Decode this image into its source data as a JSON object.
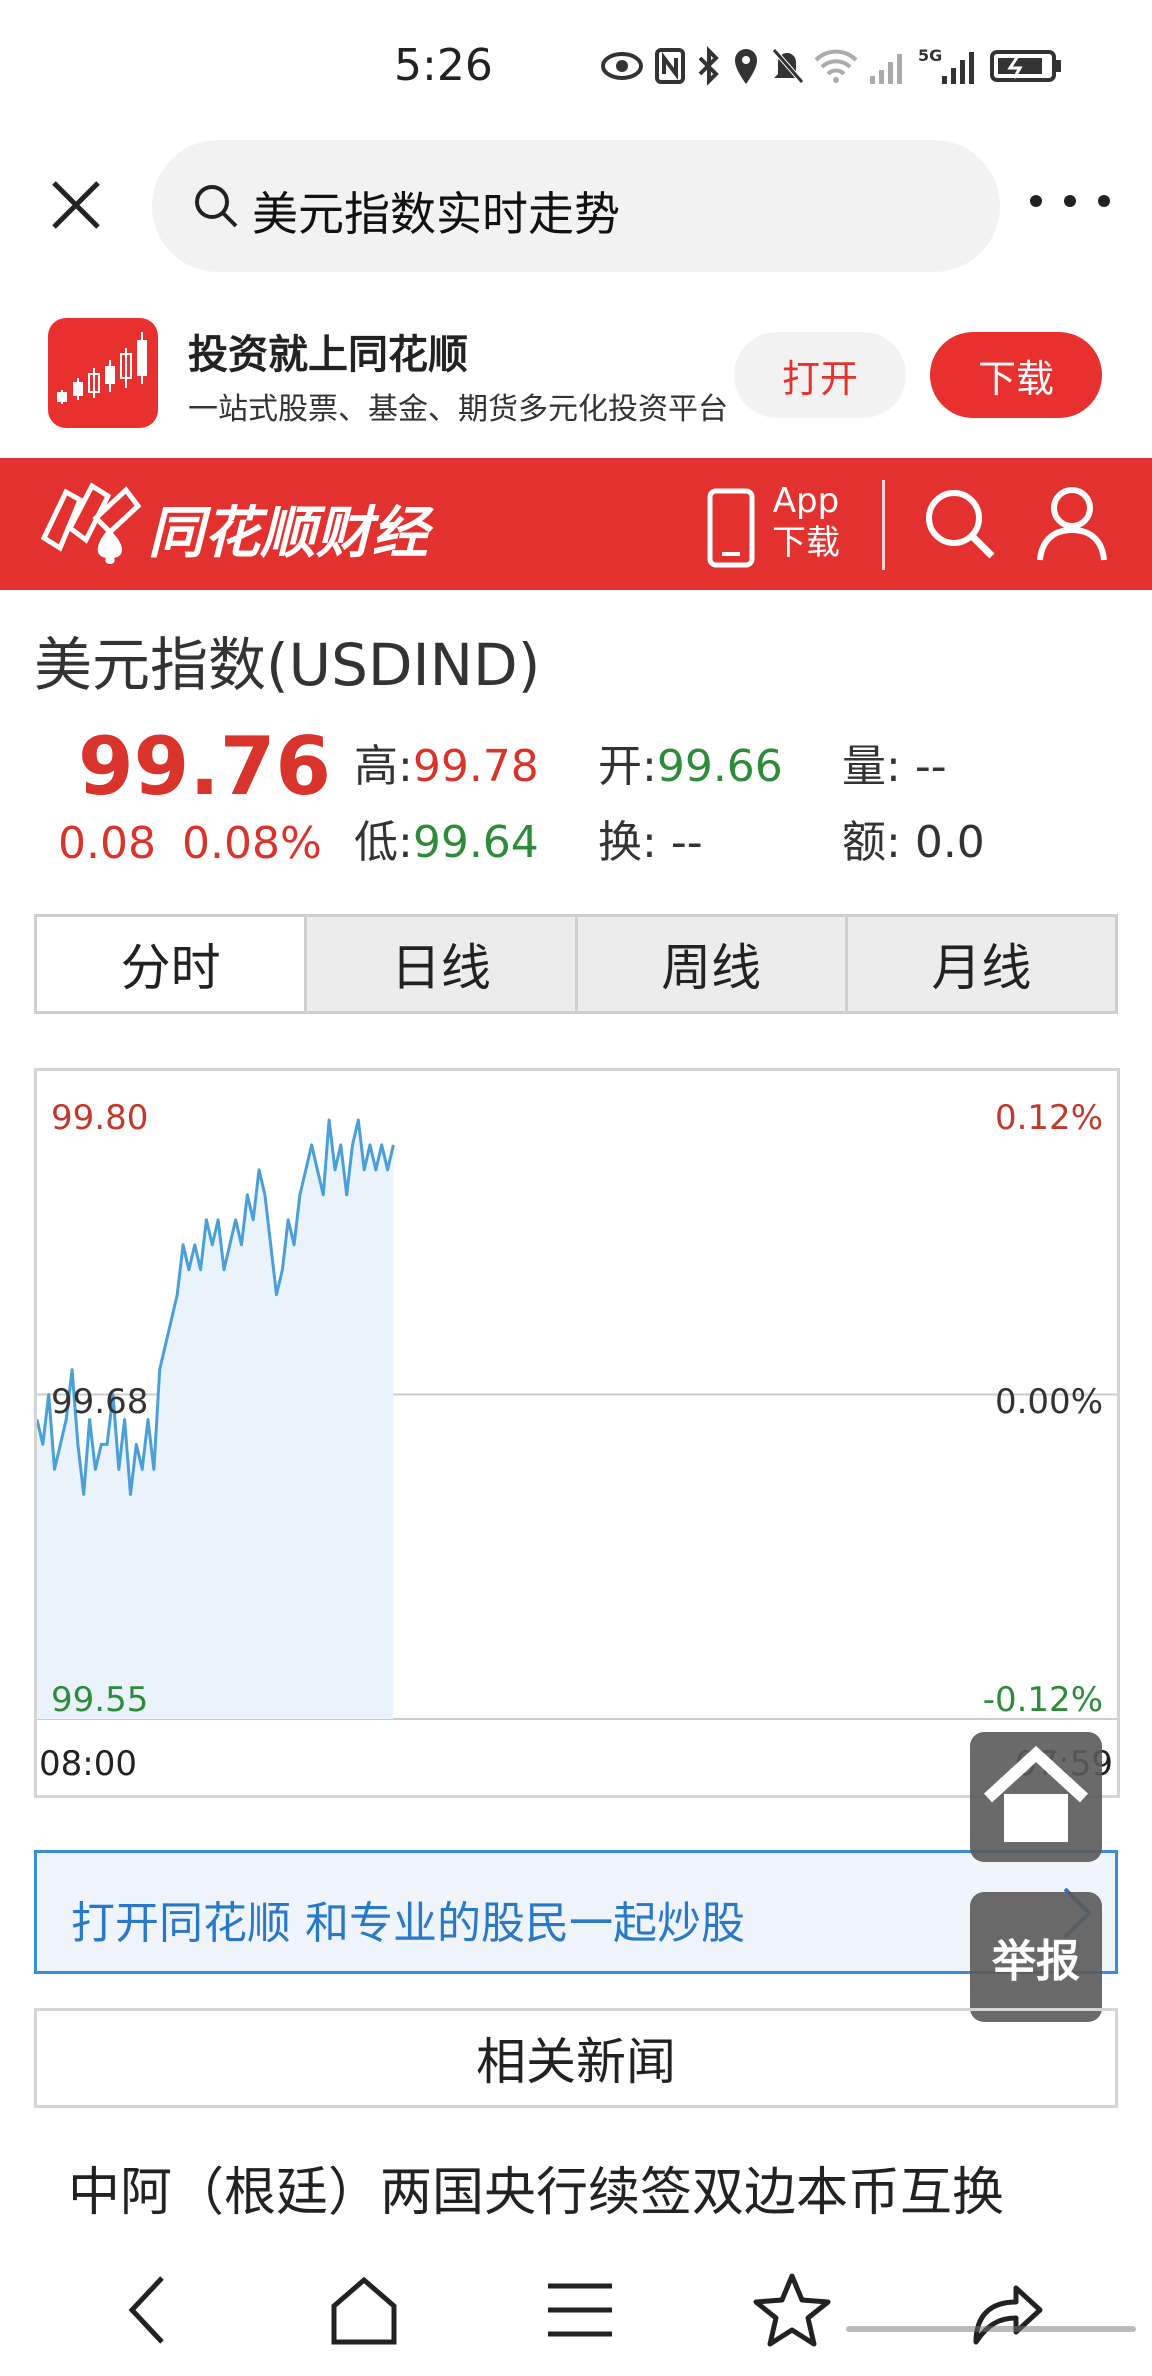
{
  "status_bar": {
    "time": "5:26",
    "icons": [
      "eye-icon",
      "nfc-icon",
      "bluetooth-icon",
      "location-icon",
      "mute-icon",
      "wifi-icon",
      "signal-icon",
      "5g-signal-icon",
      "battery-icon"
    ],
    "network_label": "5G"
  },
  "browser": {
    "query": "美元指数实时走势"
  },
  "promo": {
    "title": "投资就上同花顺",
    "subtitle": "一站式股票、基金、期货多元化投资平台",
    "open_label": "打开",
    "download_label": "下载"
  },
  "site_header": {
    "name": "同花顺财经",
    "app_line1": "App",
    "app_line2": "下载"
  },
  "quote": {
    "name": "美元指数(USDIND)",
    "price": "99.76",
    "change": "0.08",
    "change_pct": "0.08%",
    "stats": {
      "high_label": "高:",
      "high_value": "99.78",
      "open_label": "开:",
      "open_value": "99.66",
      "volume_label": "量:",
      "volume_value": "--",
      "low_label": "低:",
      "low_value": "99.64",
      "turnover_label": "换:",
      "turnover_value": "--",
      "amount_label": "额:",
      "amount_value": "0.0"
    },
    "colors": {
      "up": "#d9342b",
      "down": "#2e8b3a"
    }
  },
  "tabs": [
    "分时",
    "日线",
    "周线",
    "月线"
  ],
  "chart_data": {
    "type": "area",
    "y_left_labels": [
      "99.80",
      "99.68",
      "99.55"
    ],
    "y_right_labels": [
      "0.12%",
      "0.00%",
      "-0.12%"
    ],
    "x_labels": [
      "08:00",
      "07:59"
    ],
    "ylim": [
      99.55,
      99.8
    ],
    "base": 99.68,
    "line_color": "#4a9fd8",
    "fill_color": "#eaf3fc",
    "x_fraction_covered": 0.33,
    "series": [
      {
        "values": [
          99.67,
          99.66,
          99.68,
          99.65,
          99.66,
          99.67,
          99.69,
          99.66,
          99.64,
          99.67,
          99.65,
          99.66,
          99.66,
          99.68,
          99.65,
          99.67,
          99.64,
          99.66,
          99.65,
          99.67,
          99.65,
          99.69,
          99.7,
          99.71,
          99.72,
          99.74,
          99.73,
          99.74,
          99.73,
          99.75,
          99.74,
          99.75,
          99.73,
          99.74,
          99.75,
          99.74,
          99.76,
          99.75,
          99.77,
          99.76,
          99.74,
          99.72,
          99.73,
          99.75,
          99.74,
          99.76,
          99.77,
          99.78,
          99.77,
          99.76,
          99.79,
          99.77,
          99.78,
          99.76,
          99.78,
          99.79,
          99.77,
          99.78,
          99.77,
          99.78,
          99.77,
          99.78
        ]
      }
    ]
  },
  "banner": {
    "text": "打开同花顺 和专业的股民一起炒股"
  },
  "float_report": "举报",
  "news": {
    "section_title": "相关新闻",
    "headline": "中阿（根廷）两国央行续签双边本币互换"
  }
}
